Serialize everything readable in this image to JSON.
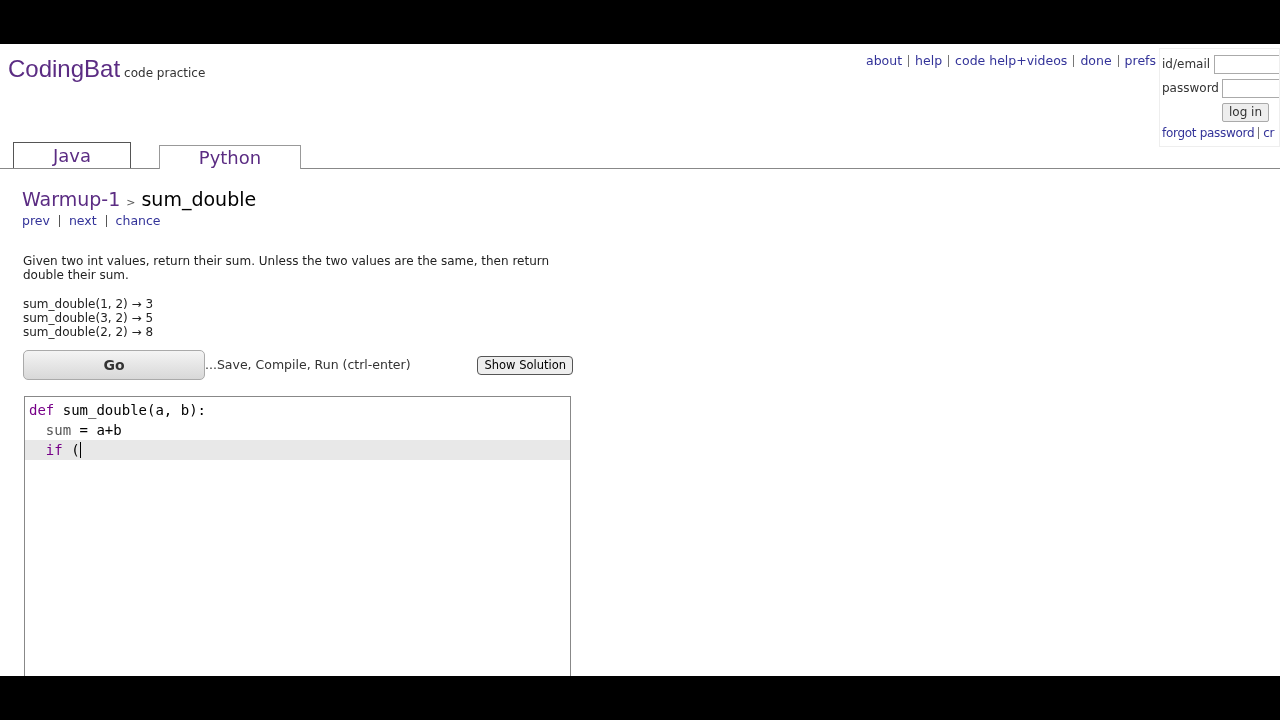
{
  "header": {
    "logo": "CodingBat",
    "tagline": "code practice",
    "nav_links": [
      "about",
      "help",
      "code help+videos",
      "done",
      "prefs"
    ],
    "login": {
      "id_label": "id/email",
      "password_label": "password",
      "button": "log in",
      "links": [
        "forgot password",
        "cr"
      ]
    }
  },
  "tabs": [
    {
      "label": "Java",
      "selected": false
    },
    {
      "label": "Python",
      "selected": true
    }
  ],
  "breadcrumb": {
    "section": "Warmup-1",
    "separator": ">",
    "problem": "sum_double"
  },
  "problem_nav": [
    "prev",
    "next",
    "chance"
  ],
  "description": "Given two int values, return their sum. Unless the two values are the same, then return double their sum.",
  "examples": [
    "sum_double(1, 2) → 3",
    "sum_double(3, 2) → 5",
    "sum_double(2, 2) → 8"
  ],
  "go_button": "Go",
  "run_hint": "...Save, Compile, Run (ctrl-enter)",
  "solution_button": "Show Solution",
  "editor": {
    "lines": [
      {
        "active": false,
        "tokens": [
          {
            "kind": "keyword",
            "text": "def"
          },
          {
            "kind": "plain",
            "text": " sum_double(a, b):"
          }
        ]
      },
      {
        "active": false,
        "tokens": [
          {
            "kind": "variable",
            "text": "  sum"
          },
          {
            "kind": "plain",
            "text": " = a+b"
          }
        ]
      },
      {
        "active": true,
        "tokens": [
          {
            "kind": "keyword",
            "text": "  if"
          },
          {
            "kind": "plain",
            "text": " ("
          }
        ]
      }
    ]
  }
}
